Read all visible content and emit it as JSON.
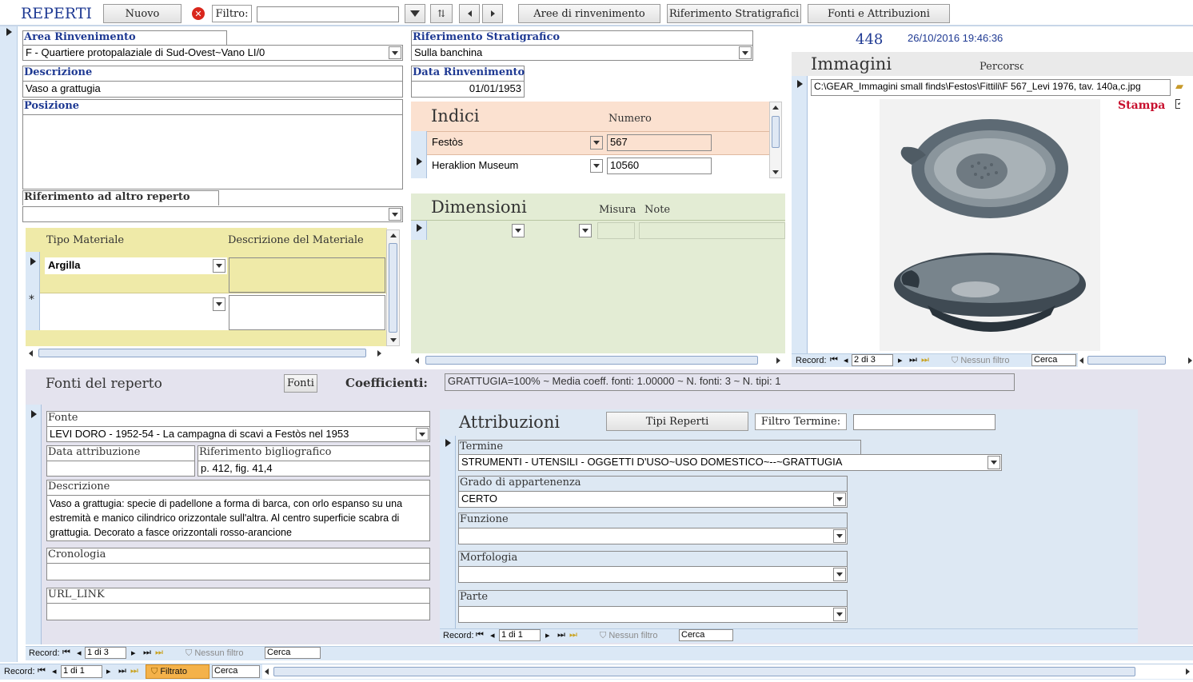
{
  "toolbar": {
    "title": "REPERTI",
    "nuovo": "Nuovo",
    "filtro_label": "Filtro:",
    "filtro_value": "",
    "btn_aree": "Aree di rinvenimento",
    "btn_rif": "Riferimento Stratigrafici",
    "btn_fonti": "Fonti e Attribuzioni"
  },
  "header": {
    "record_id": "448",
    "timestamp": "26/10/2016 19:46:36"
  },
  "left": {
    "area_label": "Area Rinvenimento",
    "area_value": "F - Quartiere protopalaziale di Sud-Ovest~Vano LI/0",
    "descr_label": "Descrizione",
    "descr_value": "Vaso a grattugia",
    "pos_label": "Posizione",
    "pos_value": "",
    "rif_label": "Riferimento ad altro reperto",
    "rif_value": ""
  },
  "materiali": {
    "col_tipo": "Tipo Materiale",
    "col_descr": "Descrizione del Materiale",
    "rows": [
      {
        "tipo": "Argilla",
        "descr": ""
      },
      {
        "tipo": "",
        "descr": ""
      }
    ],
    "new_marker": "*"
  },
  "mid": {
    "strat_label": "Riferimento Stratigrafico",
    "strat_value": "Sulla banchina",
    "data_label": "Data Rinvenimento",
    "data_value": "01/01/1953"
  },
  "indici": {
    "title": "Indici",
    "col_num": "Numero",
    "rows": [
      {
        "nome": "Festòs",
        "numero": "567"
      },
      {
        "nome": "Heraklion Museum",
        "numero": "10560"
      }
    ]
  },
  "dimensioni": {
    "title": "Dimensioni",
    "col_misura": "Misura",
    "col_note": "Note"
  },
  "immagini": {
    "title": "Immagini",
    "percorso_label": "Percorso",
    "path": "C:\\GEAR_Immagini small finds\\Festos\\Fittili\\F 567_Levi 1976, tav. 140a,c.jpg",
    "stampa": "Stampa",
    "stampa_checked": true,
    "nav": {
      "record": "Record:",
      "pos": "2 di 3",
      "filter": "Nessun filtro",
      "search": "Cerca"
    }
  },
  "fonti": {
    "title": "Fonti del reperto",
    "btn_fonti": "Fonti",
    "coeff_label": "Coefficienti:",
    "coeff_value": "GRATTUGIA=100% ~ Media coeff. fonti:  1.00000 ~  N. fonti: 3 ~  N. tipi: 1",
    "fonte_label": "Fonte",
    "fonte_value": "LEVI DORO - 1952-54 - La campagna di scavi a Festòs nel 1953",
    "data_attr_label": "Data attribuzione",
    "data_attr_value": "",
    "rif_bib_label": "Riferimento bigliografico",
    "rif_bib_value": "p. 412, fig. 41,4",
    "descr_label": "Descrizione",
    "descr_value": "Vaso a grattugia: specie di padellone a forma di barca, con orlo espanso su una estremità e manico cilindrico orizzontale sull'altra. Al centro superficie scabra di grattugia. Decorato a fasce orizzontali rosso-arancione",
    "crono_label": "Cronologia",
    "crono_value": "",
    "url_label": "URL_LINK",
    "url_value": "",
    "nav": {
      "record": "Record:",
      "pos": "1 di 3",
      "filter": "Nessun filtro",
      "search": "Cerca"
    }
  },
  "attribuzioni": {
    "title": "Attribuzioni",
    "btn_tipi": "Tipi Reperti",
    "filtro_termine_label": "Filtro Termine:",
    "filtro_termine_value": "",
    "termine_label": "Termine",
    "termine_value": "STRUMENTI - UTENSILI - OGGETTI D'USO~USO DOMESTICO~--~GRATTUGIA",
    "grado_label": "Grado di appartenenza",
    "grado_value": "CERTO",
    "funzione_label": "Funzione",
    "funzione_value": "",
    "morfologia_label": "Morfologia",
    "morfologia_value": "",
    "parte_label": "Parte",
    "parte_value": "",
    "nav": {
      "record": "Record:",
      "pos": "1 di 1",
      "filter": "Nessun filtro",
      "search": "Cerca"
    }
  },
  "main_nav": {
    "record": "Record:",
    "pos": "1 di 1",
    "filter": "Filtrato",
    "search": "Cerca"
  },
  "colors": {
    "label_blue": "#1f3a93",
    "indici_bg": "#fbe1d0",
    "dim_bg": "#e3ecd4",
    "mat_bg": "#efeaa8",
    "lower_bg": "#e4e3ee",
    "attr_bg": "#dde8f3",
    "stampa_red": "#c8102e"
  }
}
